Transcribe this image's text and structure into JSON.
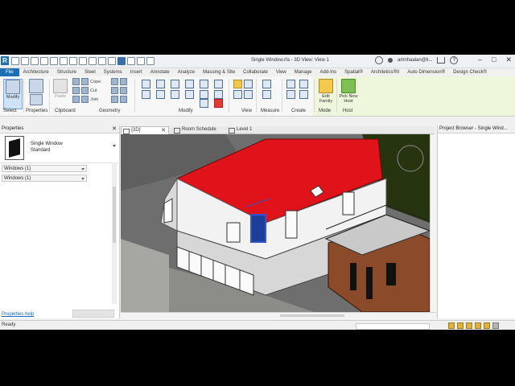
{
  "titlebar": {
    "document_title": "Single Window.rfa - 3D View: View 1",
    "user_label": "amnhaalan@li...",
    "icons": [
      "revit-logo-icon",
      "open-icon",
      "save-icon",
      "sync-icon",
      "undo-icon",
      "redo-icon",
      "print-icon",
      "measure-icon",
      "tag-icon",
      "text-icon",
      "3d-icon",
      "section-icon",
      "thin-lines-icon",
      "close-hidden-icon",
      "switch-windows-icon",
      "customize-icon"
    ]
  },
  "ribbon_tabs": [
    "File",
    "Architecture",
    "Structure",
    "Steel",
    "Systems",
    "Insert",
    "Annotate",
    "Analyze",
    "Massing & Site",
    "Collaborate",
    "View",
    "Manage",
    "Add-Ins",
    "Spatial®",
    "Architetics®II",
    "Auto Dimension®",
    "Design Check®"
  ],
  "ribbon": {
    "modify_label": "Modify",
    "select_label": "Select",
    "properties_label": "Properties",
    "paste_label": "Paste",
    "cope_label": "Cope",
    "cut_label": "Cut",
    "join_label": "Join",
    "clipboard_label": "Clipboard",
    "geometry_label": "Geometry",
    "modify_panel_label": "Modify",
    "view_panel_label": "View",
    "measure_panel_label": "Measure",
    "create_panel_label": "Create",
    "edit_family_label": "Edit Family",
    "pick_new_host_label": "Pick New Host",
    "mode_panel_label": "Mode",
    "host_panel_label": "Host"
  },
  "properties": {
    "header": "Properties",
    "type_name_line1": "Single Window",
    "type_name_line2": "Standard",
    "filter_selected": "Windows (1)",
    "edit_type_selected": "Windows (1)",
    "help_link": "Properties help"
  },
  "view_tabs": [
    {
      "label": "{3D}",
      "active": true
    },
    {
      "label": "Room Schedule",
      "active": false
    },
    {
      "label": "Level 1",
      "active": false
    }
  ],
  "project_browser": {
    "header": "Project Browser - Single Wind..."
  },
  "status": {
    "text": "Ready"
  },
  "colors": {
    "roof": "#e0131b",
    "wall": "#f3f3f3",
    "deck": "#8b4b2a",
    "grass": "#2a3a17",
    "accent": "#1f6fb5",
    "selected_window": "#3355cc"
  }
}
